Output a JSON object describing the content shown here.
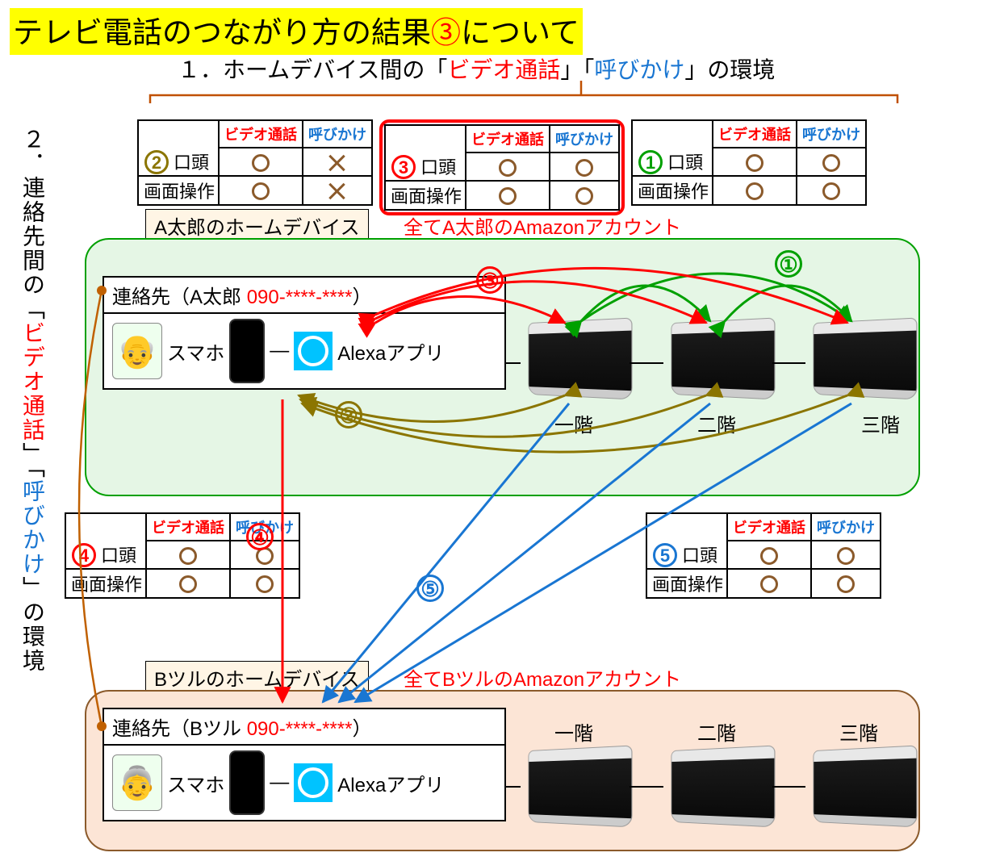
{
  "title": {
    "pre": "テレビ電話のつながり方の結果",
    "num": "③",
    "post": "について"
  },
  "section1": {
    "pre": "１．ホームデバイス間の「",
    "vid": "ビデオ通話",
    "mid": "」「",
    "call": "呼びかけ",
    "post": "」の環境"
  },
  "section2": {
    "pre": "２．連絡先間の「",
    "vid": "ビデオ通話",
    "mid": "」「",
    "call": "呼びかけ",
    "post": "」の環境"
  },
  "tableHeaders": {
    "video": "ビデオ通話",
    "call": "呼びかけ",
    "row1": "口頭",
    "row2": "画面操作"
  },
  "tables": [
    {
      "num": "②",
      "color": "c-olive",
      "r1v": "O",
      "r1c": "X",
      "r2v": "O",
      "r2c": "X"
    },
    {
      "num": "③",
      "color": "c-red",
      "r1v": "O",
      "r1c": "O",
      "r2v": "O",
      "r2c": "O",
      "highlight": true
    },
    {
      "num": "①",
      "color": "c-green",
      "r1v": "O",
      "r1c": "O",
      "r2v": "O",
      "r2c": "O"
    }
  ],
  "table4": {
    "num": "④",
    "color": "c-red",
    "r1v": "O",
    "r1c": "O",
    "r2v": "O",
    "r2c": "O"
  },
  "table5": {
    "num": "⑤",
    "color": "c-blue",
    "r1v": "O",
    "r1c": "O",
    "r2v": "O",
    "r2c": "O"
  },
  "groupA": {
    "devLabel": "A太郎のホームデバイス",
    "acctLabel": "全てA太郎のAmazonアカウント",
    "contactLabel": "連絡先",
    "contactName": "（A太郎 ",
    "contactPhone": "090-****-****",
    "contactPost": "）",
    "smartphone": "スマホ",
    "alexaApp": "Alexaアプリ",
    "floor1": "一階",
    "floor2": "二階",
    "floor3": "三階"
  },
  "groupB": {
    "devLabel": "Bツルのホームデバイス",
    "acctLabel": "全てBツルのAmazonアカウント",
    "contactLabel": "連絡先",
    "contactName": "（Bツル ",
    "contactPhone": "090-****-****",
    "contactPost": "）",
    "smartphone": "スマホ",
    "alexaApp": "Alexaアプリ",
    "floor1": "一階",
    "floor2": "二階",
    "floor3": "三階"
  },
  "floatNums": {
    "n1": "①",
    "n2": "②",
    "n3": "③",
    "n4": "④",
    "n5": "⑤"
  }
}
